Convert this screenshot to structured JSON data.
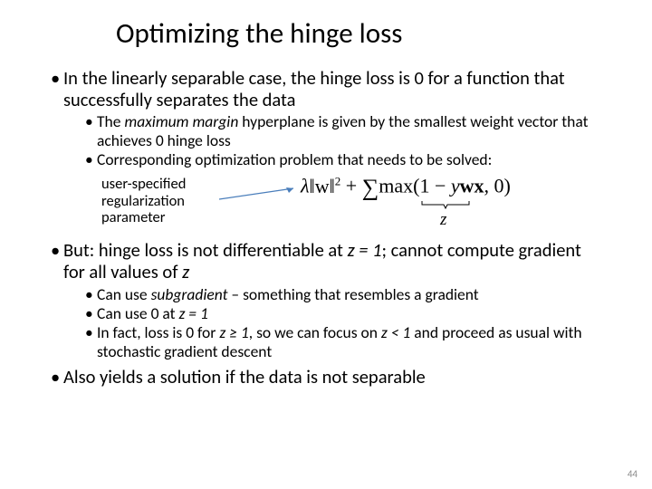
{
  "title": "Optimizing the hinge loss",
  "bullets": {
    "b1": "In the linearly separable case, the hinge loss is 0 for a function that successfully separates the data",
    "b1a_pre": "The ",
    "b1a_em": "maximum margin",
    "b1a_post": " hyperplane is given by the smallest weight vector that achieves 0 hinge loss",
    "b1b": "Corresponding optimization problem that needs to be solved:",
    "reg_label_l1": "user-specified",
    "reg_label_l2": "regularization",
    "reg_label_l3": "parameter",
    "z_label": "z",
    "b2_pre": "But: hinge loss is not differentiable at ",
    "b2_mid": "z = 1",
    "b2_post": "; cannot compute gradient for all values of ",
    "b2_end": "z",
    "b2a_pre": "Can use ",
    "b2a_em": "subgradient",
    "b2a_post": " – something that resembles a gradient",
    "b2b_pre": "Can use 0 at ",
    "b2b_em": "z = 1",
    "b2c_pre": "In fact, loss is 0 for ",
    "b2c_mid1": "z ≥ 1",
    "b2c_txt2": ", so we can focus on  ",
    "b2c_mid2": "z < 1",
    "b2c_post": " and proceed as usual with stochastic gradient descent",
    "b3": "Also yields a solution if the data is not separable"
  },
  "formula": {
    "lambda": "λ",
    "w_norm": "‖w‖",
    "sq": "2",
    "plus": " + ",
    "sum": "∑",
    "max": "max(1 − ",
    "y": "y",
    "wx": "wx",
    "tail": ", 0)"
  },
  "page_number": "44"
}
